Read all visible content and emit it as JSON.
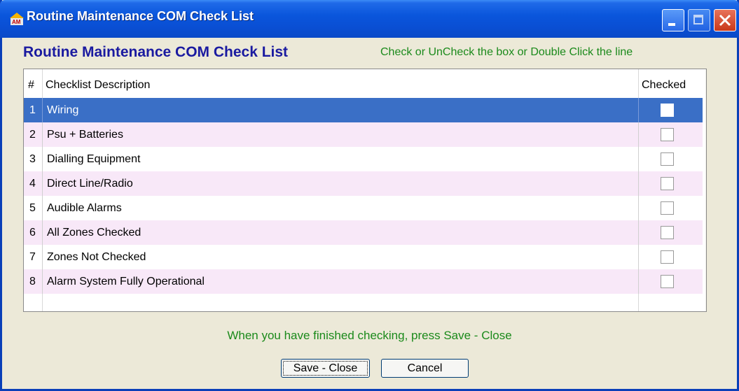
{
  "window": {
    "title": "Routine Maintenance COM Check List",
    "app_icon": "am-app-icon",
    "buttons": [
      "minimize",
      "maximize",
      "close"
    ]
  },
  "header": {
    "heading": "Routine Maintenance COM Check List",
    "instruction": "Check or UnCheck the box or Double Click the line"
  },
  "grid": {
    "columns": [
      "#",
      "Checklist Description",
      "Checked"
    ],
    "selected_row": 1,
    "rows": [
      {
        "num": "1",
        "description": "Wiring",
        "checked": false
      },
      {
        "num": "2",
        "description": "Psu + Batteries",
        "checked": false
      },
      {
        "num": "3",
        "description": "Dialling Equipment",
        "checked": false
      },
      {
        "num": "4",
        "description": "Direct Line/Radio",
        "checked": false
      },
      {
        "num": "5",
        "description": "Audible Alarms",
        "checked": false
      },
      {
        "num": "6",
        "description": "All Zones Checked",
        "checked": false
      },
      {
        "num": "7",
        "description": "Zones Not Checked",
        "checked": false
      },
      {
        "num": "8",
        "description": "Alarm System Fully Operational",
        "checked": false
      }
    ]
  },
  "footer": {
    "message": "When you have finished checking, press Save - Close",
    "save_label": "Save - Close",
    "cancel_label": "Cancel"
  },
  "colors": {
    "title_blue": "#0a56dc",
    "heading_navy": "#1a1aa0",
    "instruction_green": "#1b8a1b",
    "selection_blue": "#3a6fc6",
    "alt_row_pink": "#f8e8f8"
  }
}
